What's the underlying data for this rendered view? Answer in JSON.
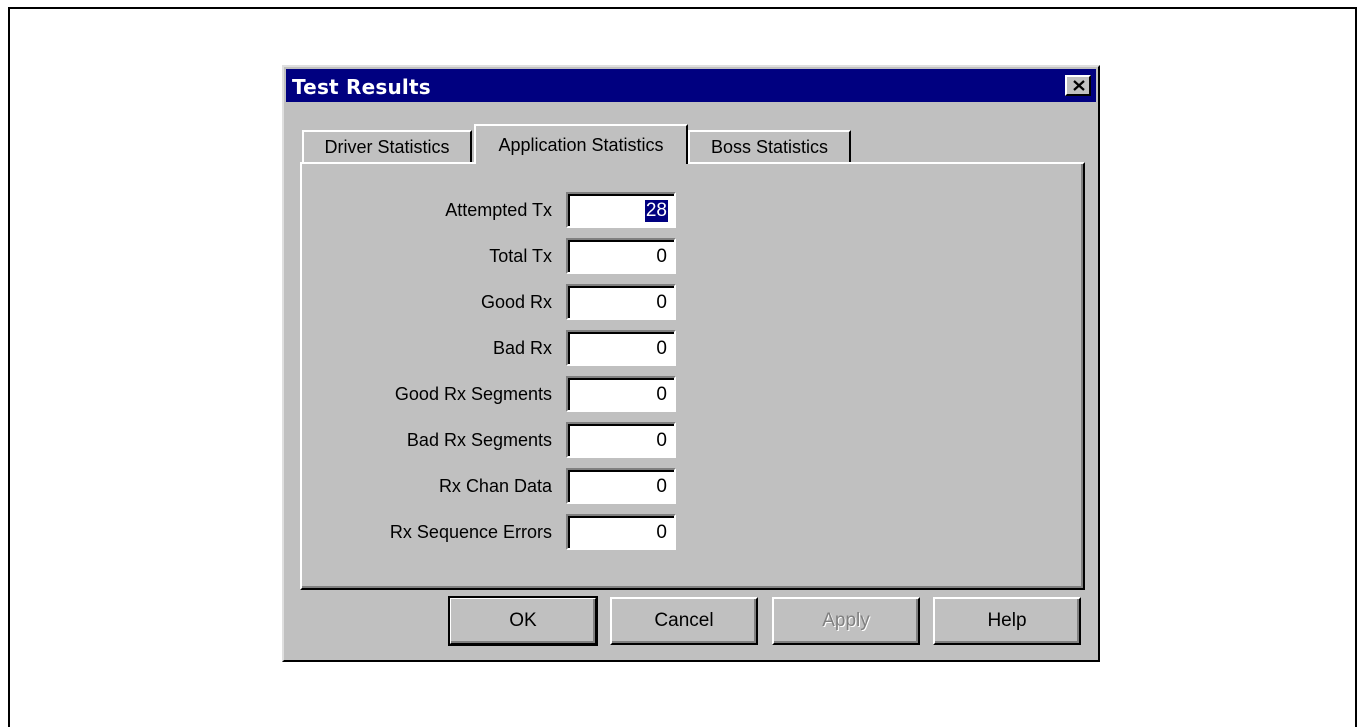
{
  "dialog": {
    "title": "Test Results",
    "close_icon": "close-x-icon"
  },
  "tabs": [
    {
      "label": "Driver Statistics",
      "active": false
    },
    {
      "label": "Application Statistics",
      "active": true
    },
    {
      "label": "Boss Statistics",
      "active": false
    }
  ],
  "fields": [
    {
      "label": "Attempted Tx",
      "value": "28",
      "selected": true
    },
    {
      "label": "Total Tx",
      "value": "0"
    },
    {
      "label": "Good Rx",
      "value": "0"
    },
    {
      "label": "Bad Rx",
      "value": "0"
    },
    {
      "label": "Good Rx Segments",
      "value": "0"
    },
    {
      "label": "Bad Rx Segments",
      "value": "0"
    },
    {
      "label": "Rx Chan Data",
      "value": "0"
    },
    {
      "label": "Rx Sequence Errors",
      "value": "0"
    }
  ],
  "buttons": {
    "ok": "OK",
    "cancel": "Cancel",
    "apply": "Apply",
    "help": "Help"
  },
  "colors": {
    "titlebar": "#000080",
    "face": "#c0c0c0"
  }
}
